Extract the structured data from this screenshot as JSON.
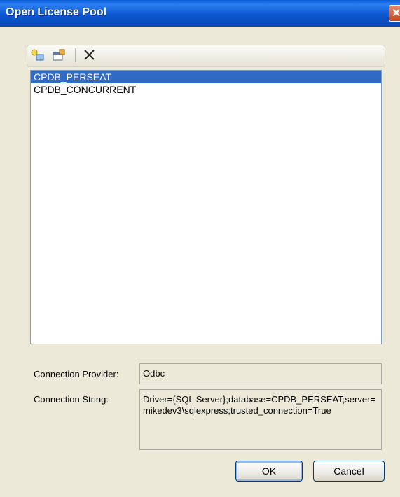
{
  "window": {
    "title": "Open License Pool"
  },
  "toolbar": {
    "new_icon": "new-item-icon",
    "properties_icon": "properties-icon",
    "delete_icon": "delete-icon"
  },
  "list": {
    "items": [
      {
        "label": "CPDB_PERSEAT",
        "selected": true
      },
      {
        "label": "CPDB_CONCURRENT",
        "selected": false
      }
    ]
  },
  "form": {
    "provider_label": "Connection Provider:",
    "provider_value": "Odbc",
    "string_label": "Connection String:",
    "string_value": "Driver={SQL Server};database=CPDB_PERSEAT;server=mikedev3\\sqlexpress;trusted_connection=True"
  },
  "buttons": {
    "ok": "OK",
    "cancel": "Cancel"
  },
  "colors": {
    "titlebar": "#0a5fd8",
    "selection": "#316ac5",
    "dialog_bg": "#ece9d8"
  }
}
